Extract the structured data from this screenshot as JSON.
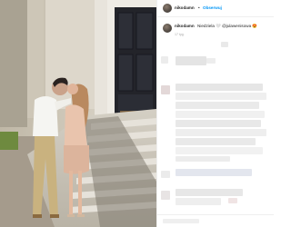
{
  "post": {
    "username": "nikodamn",
    "separator": "•",
    "follow_label": "Obserwuj",
    "caption_text": "Niedziela 🤍 @julawenisowa 😍",
    "caption_username": "nikodamn",
    "time_label": "17 tyg."
  }
}
